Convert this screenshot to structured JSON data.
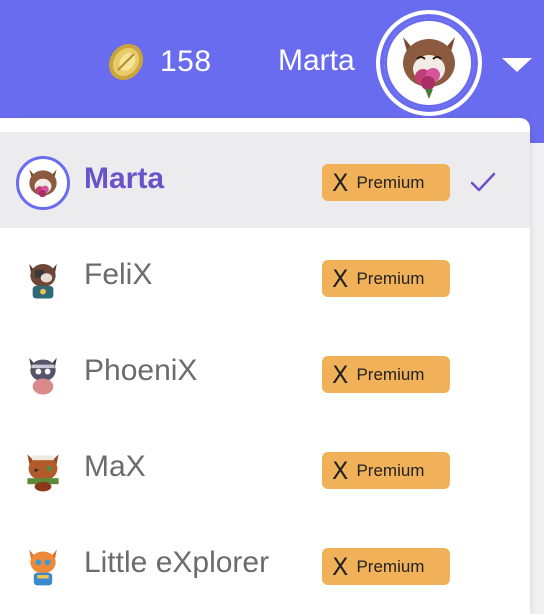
{
  "header": {
    "coins": "158",
    "user_name": "Marta",
    "accent": "#6a6cf0",
    "coin_icon": "coin-icon",
    "avatar_icon": "cat-avatar-icon",
    "caret_icon": "chevron-down-icon"
  },
  "menu": {
    "items": [
      {
        "name": "Marta",
        "badge_x": "X",
        "badge_label": "Premium",
        "selected": true
      },
      {
        "name": "FeliX",
        "badge_x": "X",
        "badge_label": "Premium",
        "selected": false
      },
      {
        "name": "PhoeniX",
        "badge_x": "X",
        "badge_label": "Premium",
        "selected": false
      },
      {
        "name": "MaX",
        "badge_x": "X",
        "badge_label": "Premium",
        "selected": false
      },
      {
        "name": "Little eXplorer",
        "badge_x": "X",
        "badge_label": "Premium",
        "selected": false
      }
    ],
    "badge_color": "#f1b158",
    "selected_name_color": "#6a52c9"
  }
}
